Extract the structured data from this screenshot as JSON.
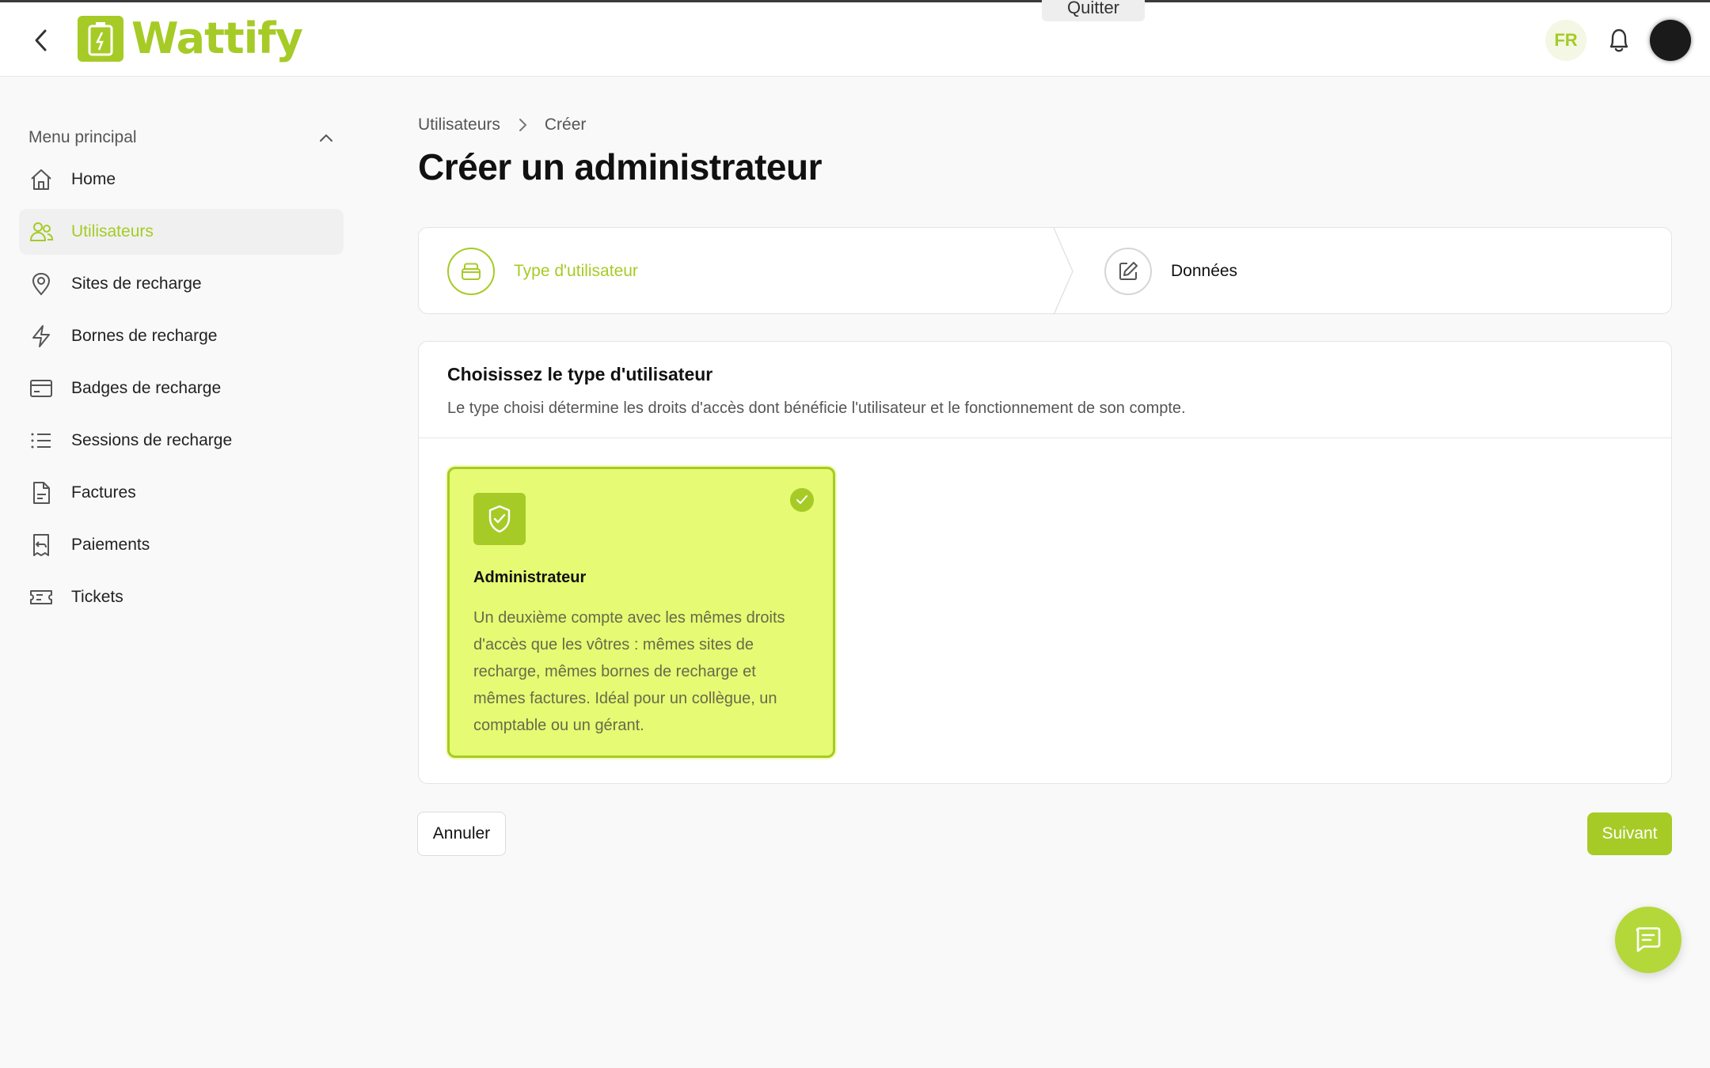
{
  "header": {
    "back_label": "",
    "brand_name": "Wattify",
    "banner_text": "",
    "quit_label": "Quitter",
    "lang": "FR"
  },
  "sidebar": {
    "menu_title": "Menu principal",
    "items": [
      {
        "label": "Home",
        "icon": "home-icon"
      },
      {
        "label": "Utilisateurs",
        "icon": "users-icon",
        "active": true
      },
      {
        "label": "Sites de recharge",
        "icon": "map-pin-icon"
      },
      {
        "label": "Bornes de recharge",
        "icon": "bolt-icon"
      },
      {
        "label": "Badges de recharge",
        "icon": "card-icon"
      },
      {
        "label": "Sessions de recharge",
        "icon": "list-icon"
      },
      {
        "label": "Factures",
        "icon": "document-icon"
      },
      {
        "label": "Paiements",
        "icon": "receipt-icon"
      },
      {
        "label": "Tickets",
        "icon": "ticket-icon"
      }
    ]
  },
  "breadcrumb": {
    "parent": "Utilisateurs",
    "current": "Créer"
  },
  "page": {
    "title": "Créer un administrateur"
  },
  "stepper": {
    "steps": [
      {
        "label": "Type d'utilisateur",
        "icon": "box-icon",
        "state": "active"
      },
      {
        "label": "Données",
        "icon": "edit-icon",
        "state": "pending"
      }
    ]
  },
  "card": {
    "title": "Choisissez le type d'utilisateur",
    "subtitle": "Le type choisi détermine les droits d'accès dont bénéficie l'utilisateur et le fonctionnement de son compte.",
    "options": [
      {
        "title": "Administrateur",
        "description": "Un deuxième compte avec les mêmes droits d'accès que les vôtres : mêmes sites de recharge, mêmes bornes de recharge et mêmes factures. Idéal pour un collègue, un comptable ou un gérant.",
        "selected": true,
        "icon": "shield-check-icon"
      }
    ]
  },
  "actions": {
    "cancel_label": "Annuler",
    "next_label": "Suivant"
  },
  "colors": {
    "accent": "#a6cb26",
    "selected_bg": "#e6fa73"
  }
}
